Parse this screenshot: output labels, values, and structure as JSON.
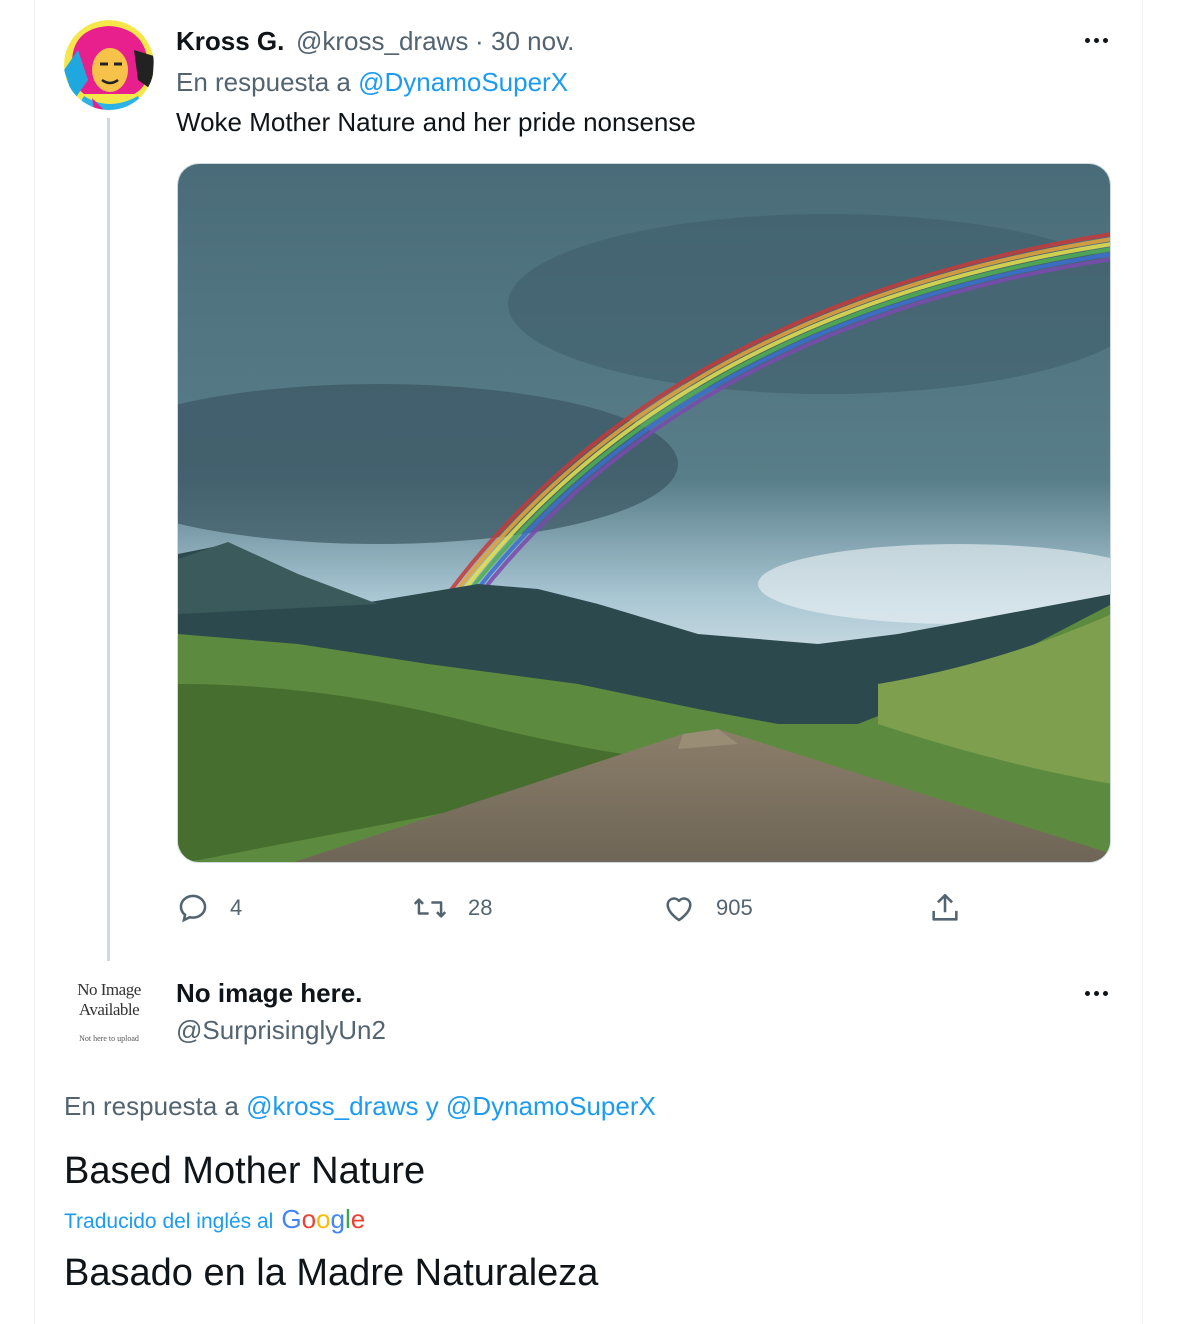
{
  "tweet1": {
    "author_name": "Kross G.",
    "handle": "@kross_draws",
    "separator": "·",
    "date": "30 nov.",
    "reply_prefix": "En respuesta a",
    "reply_to": "@DynamoSuperX",
    "text": "Woke Mother Nature and her pride nonsense",
    "actions": {
      "reply_count": "4",
      "retweet_count": "28",
      "like_count": "905"
    }
  },
  "tweet2": {
    "avatar_text_line1": "No Image",
    "avatar_text_line2": "Available",
    "avatar_text_line3": "Not here to upload",
    "author_name": "No image here.",
    "handle": "@SurprisinglyUn2",
    "reply_prefix": "En respuesta a",
    "reply_to_1": "@kross_draws",
    "reply_conj": "y",
    "reply_to_2": "@DynamoSuperX",
    "text": "Based Mother Nature",
    "translated_by": "Traducido del inglés al",
    "translation": "Basado en la Madre Naturaleza"
  },
  "icons": [
    "more-icon",
    "reply-icon",
    "retweet-icon",
    "like-icon",
    "share-icon",
    "google-logo"
  ],
  "colors": {
    "link": "#1d9bf0",
    "muted": "#536471",
    "text": "#0f1419",
    "thread_line": "#cfd9de"
  }
}
